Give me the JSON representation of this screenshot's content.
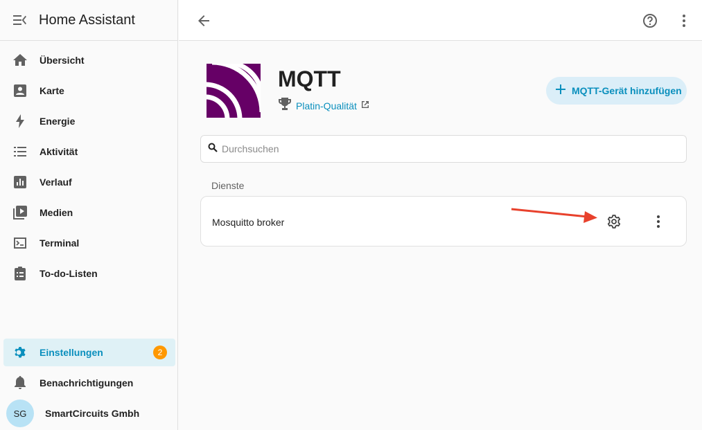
{
  "app": {
    "title": "Home Assistant"
  },
  "sidebar": {
    "items": [
      {
        "label": "Übersicht",
        "icon": "home-icon"
      },
      {
        "label": "Karte",
        "icon": "map-account-icon"
      },
      {
        "label": "Energie",
        "icon": "lightning-bolt-icon"
      },
      {
        "label": "Aktivität",
        "icon": "format-list-bulleted-icon"
      },
      {
        "label": "Verlauf",
        "icon": "chart-box-icon"
      },
      {
        "label": "Medien",
        "icon": "play-box-multiple-icon"
      },
      {
        "label": "Terminal",
        "icon": "console-icon"
      },
      {
        "label": "To-do-Listen",
        "icon": "clipboard-list-icon"
      }
    ],
    "settings": {
      "label": "Einstellungen",
      "badge": "2"
    },
    "notifications": {
      "label": "Benachrichtigungen"
    },
    "profile": {
      "initials": "SG",
      "name": "SmartCircuits Gmbh"
    }
  },
  "integration": {
    "title": "MQTT",
    "quality": "Platin-Qualität",
    "add_button": "MQTT-Gerät hinzufügen",
    "search_placeholder": "Durchsuchen",
    "section_title": "Dienste",
    "services": [
      {
        "name": "Mosquitto broker"
      }
    ]
  },
  "colors": {
    "accent": "#0a8fbd",
    "active_bg": "#dff1f6",
    "badge": "#ff9800",
    "mqtt_logo": "#660066",
    "annotation_arrow": "#e8412c"
  }
}
